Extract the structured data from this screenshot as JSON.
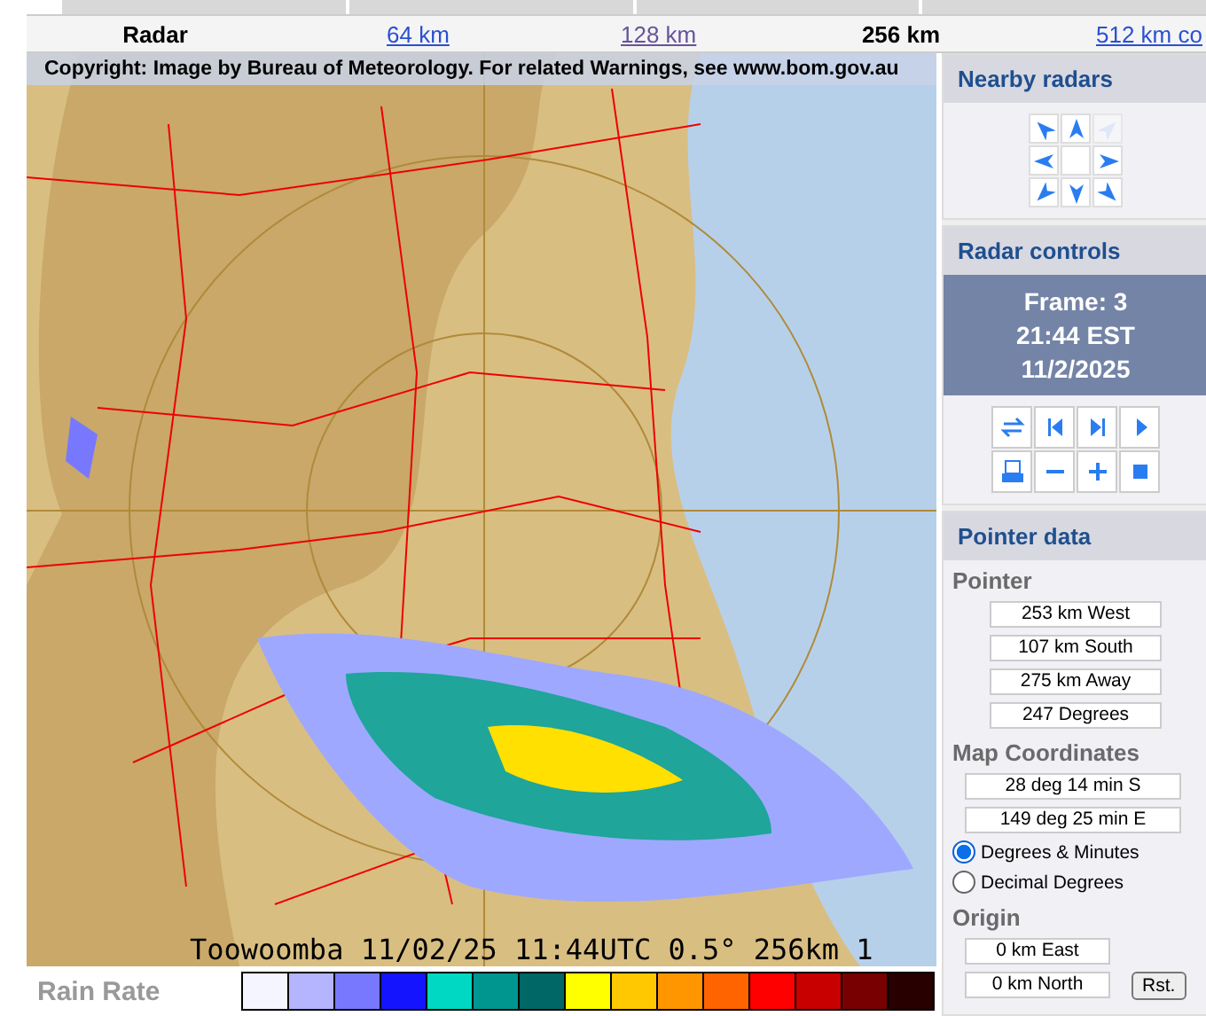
{
  "ranges": [
    {
      "label": "Radar",
      "kind": "title"
    },
    {
      "label": "64 km",
      "kind": "link",
      "selected": false,
      "visited": false
    },
    {
      "label": "128 km",
      "kind": "link",
      "selected": false,
      "visited": true
    },
    {
      "label": "256 km",
      "kind": "link",
      "selected": true,
      "visited": false
    },
    {
      "label": "512 km co",
      "kind": "link",
      "selected": false,
      "visited": false
    }
  ],
  "map": {
    "copyright": "Copyright: Image by Bureau of Meteorology. For related Warnings, see www.bom.gov.au",
    "caption": "Toowoomba 11/02/25 11:44UTC 0.5° 256km 1"
  },
  "legend": {
    "title": "Rain Rate",
    "swatches": [
      {
        "color": "#f5f5ff"
      },
      {
        "color": "#b4b4ff"
      },
      {
        "color": "#7878ff"
      },
      {
        "color": "#1414ff"
      },
      {
        "color": "#00d8c3"
      },
      {
        "color": "#009690"
      },
      {
        "color": "#006666"
      },
      {
        "color": "#ffff00"
      },
      {
        "color": "#ffc800"
      },
      {
        "color": "#ff9600"
      },
      {
        "color": "#ff6400"
      },
      {
        "color": "#ff0000"
      },
      {
        "color": "#c80000"
      },
      {
        "color": "#780000"
      },
      {
        "color": "#280000"
      }
    ]
  },
  "nearby": {
    "title": "Nearby radars",
    "arrows": [
      {
        "kind": "nw",
        "disabled": false
      },
      {
        "kind": "n",
        "disabled": false
      },
      {
        "kind": "ne",
        "disabled": true
      },
      {
        "kind": "w",
        "disabled": false
      },
      {
        "kind": "none"
      },
      {
        "kind": "e",
        "disabled": false
      },
      {
        "kind": "sw",
        "disabled": false
      },
      {
        "kind": "s",
        "disabled": false
      },
      {
        "kind": "se",
        "disabled": false
      }
    ]
  },
  "controls": {
    "title": "Radar controls",
    "frame": "Frame: 3",
    "time": "21:44 EST",
    "date": "11/2/2025"
  },
  "pointer": {
    "title": "Pointer data",
    "pointer_heading": "Pointer",
    "readings": [
      "253 km West",
      "107 km South",
      "275 km Away",
      "247 Degrees"
    ],
    "coords_heading": "Map Coordinates",
    "coords": [
      "28 deg 14 min S",
      "149 deg 25 min E"
    ],
    "formats": [
      {
        "label": "Degrees & Minutes",
        "selected": true
      },
      {
        "label": "Decimal Degrees",
        "selected": false
      }
    ],
    "origin_heading": "Origin",
    "origin": [
      "0 km East",
      "0 km North"
    ],
    "reset": "Rst."
  }
}
